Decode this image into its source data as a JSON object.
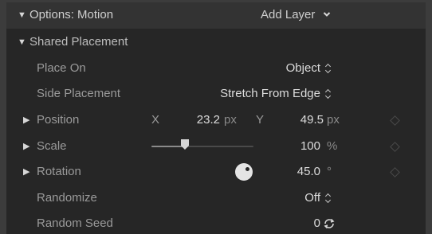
{
  "header": {
    "title": "Options: Motion",
    "add_layer": "Add Layer"
  },
  "group": {
    "label": "Shared Placement"
  },
  "rows": {
    "place_on": {
      "label": "Place On",
      "value": "Object"
    },
    "side_placement": {
      "label": "Side Placement",
      "value": "Stretch From Edge"
    },
    "position": {
      "label": "Position",
      "x_label": "X",
      "x_value": "23.2",
      "x_unit": "px",
      "y_label": "Y",
      "y_value": "49.5",
      "y_unit": "px"
    },
    "scale": {
      "label": "Scale",
      "value": "100",
      "unit": "%",
      "slider_fraction": 0.33
    },
    "rotation": {
      "label": "Rotation",
      "value": "45.0",
      "unit": "°"
    },
    "randomize": {
      "label": "Randomize",
      "value": "Off"
    },
    "random_seed": {
      "label": "Random Seed",
      "value": "0"
    }
  },
  "icons": {
    "disclosure_open": "triangle-down-icon",
    "disclosure_closed": "triangle-right-icon",
    "menu": "chevron-down-icon",
    "stepper": "up-down-stepper-icon",
    "keyframe": "keyframe-diamond-icon",
    "regenerate": "refresh-icon"
  },
  "colors": {
    "panel_bg": "#262626",
    "header_bg": "#333333",
    "label": "#9a9a9a",
    "value": "#dcdcdc",
    "dial": "#e4e4e4"
  }
}
